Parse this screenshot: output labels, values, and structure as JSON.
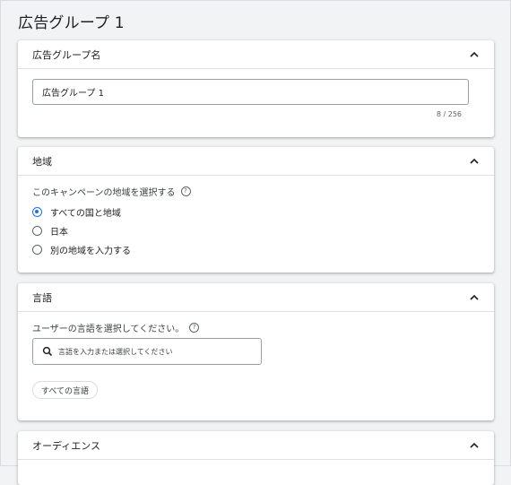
{
  "page": {
    "title": "広告グループ 1"
  },
  "ad_group_name": {
    "header": "広告グループ名",
    "input_value": "広告グループ 1",
    "counter": "8 / 256"
  },
  "locations": {
    "header": "地域",
    "prompt": "このキャンペーンの地域を選択する",
    "options": [
      {
        "label": "すべての国と地域",
        "selected": true
      },
      {
        "label": "日本",
        "selected": false
      },
      {
        "label": "別の地域を入力する",
        "selected": false
      }
    ]
  },
  "languages": {
    "header": "言語",
    "prompt": "ユーザーの言語を選択してください。",
    "search_placeholder": "言語を入力または選択してください",
    "chip": "すべての言語"
  },
  "audience": {
    "header": "オーディエンス"
  },
  "icons": {
    "collapse": "chevron-up-icon",
    "help": "help-circle-icon",
    "search": "search-icon"
  },
  "colors": {
    "accent": "#1a73e8",
    "background": "#f1f3f4",
    "card": "#ffffff"
  }
}
